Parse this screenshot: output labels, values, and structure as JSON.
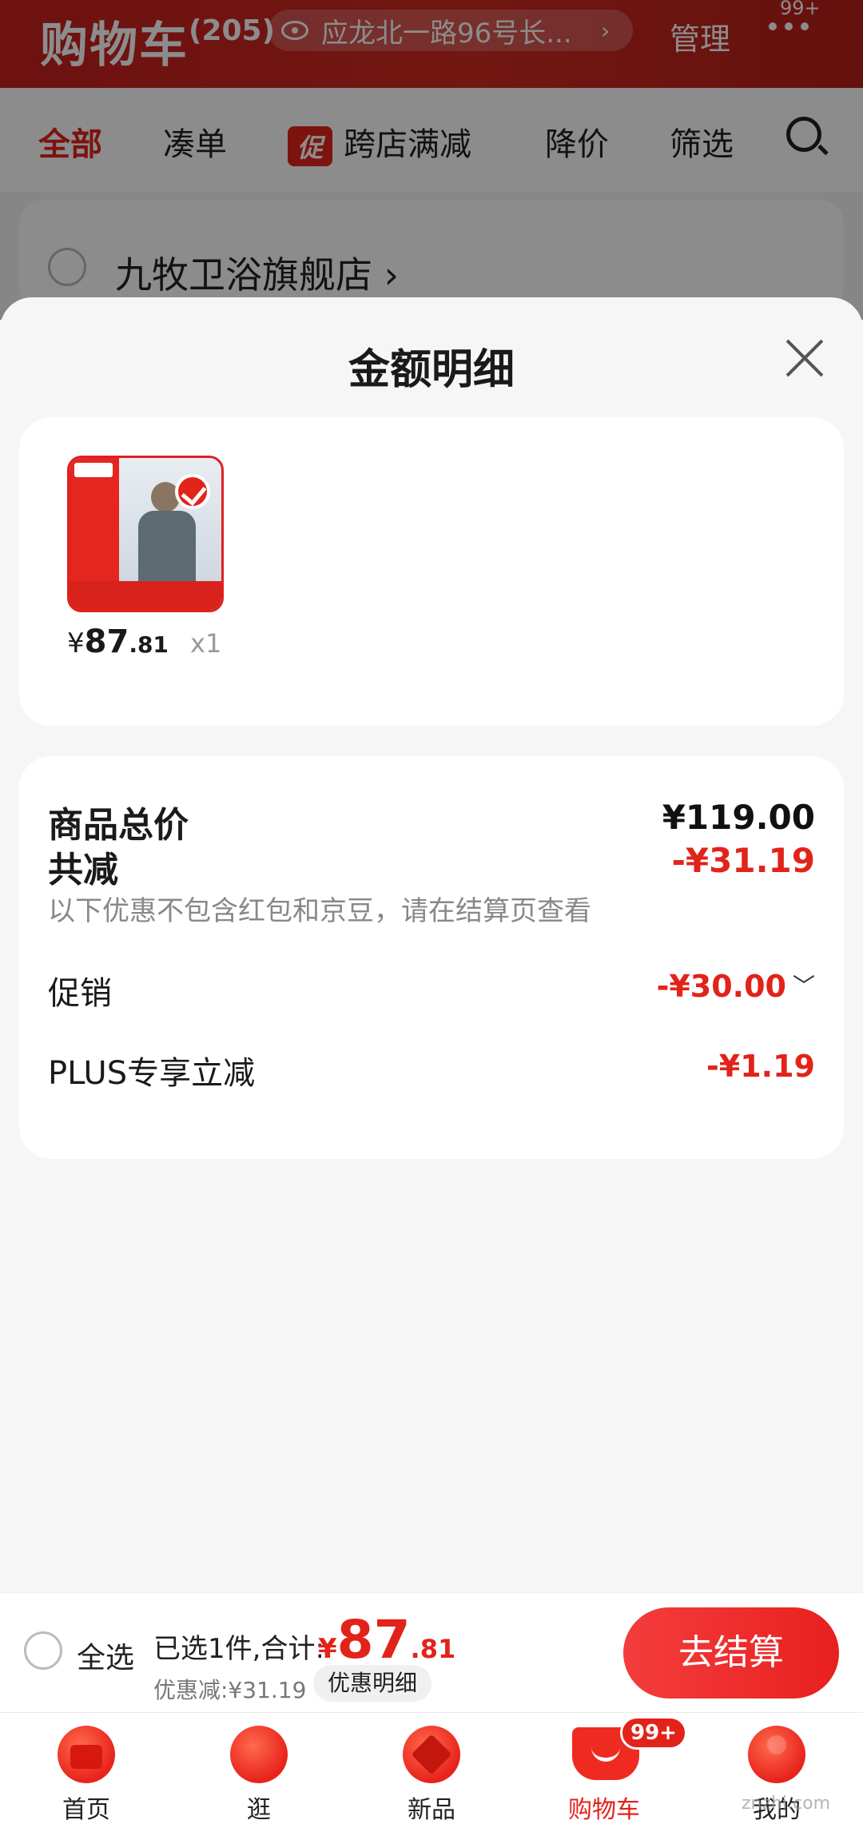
{
  "header": {
    "title": "购物车",
    "count": "(205)",
    "address": "应龙北一路96号长...",
    "address_chevron": "›",
    "manage": "管理",
    "more_badge": "99+"
  },
  "filters": [
    {
      "label": "全部"
    },
    {
      "label": "凑单"
    },
    {
      "label": "跨店满减",
      "tag": "促"
    },
    {
      "label": "降价"
    },
    {
      "label": "筛选"
    }
  ],
  "store": {
    "name": "九牧卫浴旗舰店 ›"
  },
  "sheet": {
    "title": "金额明细",
    "item": {
      "price_symbol": "¥",
      "price_int": "87",
      "price_dec": ".81",
      "qty": "x1"
    },
    "summary": {
      "total_label": "商品总价",
      "total_value": "¥119.00",
      "reduce_label": "共减",
      "reduce_value": "-¥31.19",
      "note": "以下优惠不包含红包和京豆，请在结算页查看",
      "promo_label": "促销",
      "promo_value": "-¥30.00",
      "plus_label": "PLUS专享立减",
      "plus_value": "-¥1.19"
    }
  },
  "checkout": {
    "select_all": "全选",
    "selected_text": "已选1件,合计:",
    "total_symbol": "¥",
    "total_int": "87",
    "total_dec": ".81",
    "discount_text": "优惠减:¥31.19",
    "detail_chip": "优惠明细",
    "pay_button": "去结算"
  },
  "tabbar": [
    {
      "label": "首页",
      "icon": "home-icon"
    },
    {
      "label": "逛",
      "icon": "browse-icon"
    },
    {
      "label": "新品",
      "icon": "new-products-icon"
    },
    {
      "label": "购物车",
      "icon": "cart-icon",
      "badge": "99+"
    },
    {
      "label": "我的",
      "icon": "profile-icon"
    }
  ],
  "watermark": "znzhi.com",
  "colors": {
    "accent": "#e2231a",
    "header_red": "#c8201f"
  }
}
